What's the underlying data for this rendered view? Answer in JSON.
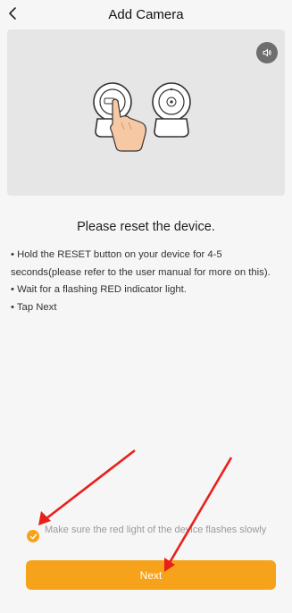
{
  "header": {
    "back_icon": "chevron-left-icon",
    "title": "Add Camera"
  },
  "illustration": {
    "sound_icon": "speaker-icon"
  },
  "content": {
    "heading": "Please reset the device.",
    "items": [
      "• Hold the RESET button on your device for 4-5 seconds(please refer to the user manual for more on this).",
      "• Wait for a flashing RED indicator light.",
      "• Tap Next"
    ]
  },
  "confirm": {
    "checked": true,
    "label": "Make sure the red light of the device flashes slowly"
  },
  "footer": {
    "next_label": "Next"
  },
  "colors": {
    "accent": "#f6a31b",
    "annotation_arrow": "#e8201a"
  }
}
